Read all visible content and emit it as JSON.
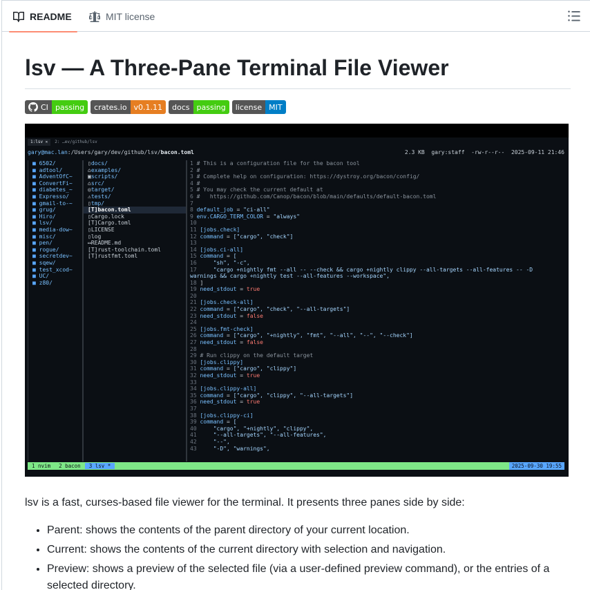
{
  "tabs": {
    "readme": "README",
    "license": "MIT license"
  },
  "title": "lsv — A Three-Pane Terminal File Viewer",
  "badges": [
    {
      "left": "CI",
      "right": "passing",
      "color": "#44cc11"
    },
    {
      "left": "crates.io",
      "right": "v0.1.11",
      "color": "#e67e22"
    },
    {
      "left": "docs",
      "right": "passing",
      "color": "#44cc11"
    },
    {
      "left": "license",
      "right": "MIT",
      "color": "#007ec6"
    }
  ],
  "terminal": {
    "tabs": [
      "1:lsv ✕",
      "2: …ev/github/lsv"
    ],
    "path_user": "gary@mac.lan",
    "path_dir": ":/Users/gary/dev/github/lsv/",
    "path_file": "bacon.toml",
    "meta": "2.3 KB  gary:staff  -rw-r--r--  2025-09-11 21:46",
    "parent_entries": [
      "6502/",
      "adtool/",
      "AdventOfC~",
      "ConvertFi~",
      "diabetes_~",
      "Expresso/",
      "gmail-to-~",
      "grug/",
      "Hiro/",
      "lsv/",
      "media-dow~",
      "misc/",
      "pen/",
      "rogue/",
      "secretdev~",
      "sqew/",
      "test_xcod~",
      "UC/",
      "z80/"
    ],
    "current_entries": [
      {
        "icon": "▯",
        "name": "docs/"
      },
      {
        "icon": "⌂",
        "name": "examples/"
      },
      {
        "icon": "▣",
        "name": "scripts/"
      },
      {
        "icon": "⌂",
        "name": "src/"
      },
      {
        "icon": "◎",
        "name": "target/"
      },
      {
        "icon": "⚠",
        "name": "tests/"
      },
      {
        "icon": "▯",
        "name": "tmp/"
      },
      {
        "icon": "[T]",
        "name": "bacon.toml"
      },
      {
        "icon": "▯",
        "name": "Cargo.lock"
      },
      {
        "icon": "[T]",
        "name": "Cargo.toml"
      },
      {
        "icon": "▯",
        "name": "LICENSE"
      },
      {
        "icon": "▯",
        "name": "log"
      },
      {
        "icon": "▭",
        "name": "README.md"
      },
      {
        "icon": "[T]",
        "name": "rust-toolchain.toml"
      },
      {
        "icon": "[T]",
        "name": "rustfmt.toml"
      }
    ],
    "preview_lines": [
      [
        "1",
        "cm",
        "# This is a configuration file for the bacon tool"
      ],
      [
        "2",
        "cm",
        "#"
      ],
      [
        "3",
        "cm",
        "# Complete help on configuration: https://dystroy.org/bacon/config/"
      ],
      [
        "4",
        "cm",
        "#"
      ],
      [
        "5",
        "cm",
        "# You may check the current default at"
      ],
      [
        "6",
        "cm",
        "#   https://github.com/Canop/bacon/blob/main/defaults/default-bacon.toml"
      ],
      [
        "7",
        "tx",
        ""
      ],
      [
        "8",
        "kv",
        "default_job = \"ci-all\""
      ],
      [
        "9",
        "kv",
        "env.CARGO_TERM_COLOR = \"always\""
      ],
      [
        "10",
        "tx",
        ""
      ],
      [
        "11",
        "hd",
        "[jobs.check]"
      ],
      [
        "12",
        "kv",
        "command = [\"cargo\", \"check\"]"
      ],
      [
        "13",
        "tx",
        ""
      ],
      [
        "14",
        "hd",
        "[jobs.ci-all]"
      ],
      [
        "15",
        "kv",
        "command = ["
      ],
      [
        "16",
        "st",
        "    \"sh\", \"-c\","
      ],
      [
        "17",
        "st",
        "    \"cargo +nightly fmt --all -- --check && cargo +nightly clippy --all-targets --all-features -- -D"
      ],
      [
        "",
        "st",
        "warnings && cargo +nightly test --all-features --workspace\","
      ],
      [
        "18",
        "tx",
        "]"
      ],
      [
        "19",
        "kb",
        "need_stdout = true"
      ],
      [
        "20",
        "tx",
        ""
      ],
      [
        "21",
        "hd",
        "[jobs.check-all]"
      ],
      [
        "22",
        "kv",
        "command = [\"cargo\", \"check\", \"--all-targets\"]"
      ],
      [
        "23",
        "kb",
        "need_stdout = false"
      ],
      [
        "24",
        "tx",
        ""
      ],
      [
        "25",
        "hd",
        "[jobs.fmt-check]"
      ],
      [
        "26",
        "kv",
        "command = [\"cargo\", \"+nightly\", \"fmt\", \"--all\", \"--\", \"--check\"]"
      ],
      [
        "27",
        "kb",
        "need_stdout = false"
      ],
      [
        "28",
        "tx",
        ""
      ],
      [
        "29",
        "cm",
        "# Run clippy on the default target"
      ],
      [
        "30",
        "hd",
        "[jobs.clippy]"
      ],
      [
        "31",
        "kv",
        "command = [\"cargo\", \"clippy\"]"
      ],
      [
        "32",
        "kb",
        "need_stdout = true"
      ],
      [
        "33",
        "tx",
        ""
      ],
      [
        "34",
        "hd",
        "[jobs.clippy-all]"
      ],
      [
        "35",
        "kv",
        "command = [\"cargo\", \"clippy\", \"--all-targets\"]"
      ],
      [
        "36",
        "kb",
        "need_stdout = true"
      ],
      [
        "37",
        "tx",
        ""
      ],
      [
        "38",
        "hd",
        "[jobs.clippy-ci]"
      ],
      [
        "39",
        "kv",
        "command = ["
      ],
      [
        "40",
        "st",
        "    \"cargo\", \"+nightly\", \"clippy\","
      ],
      [
        "41",
        "st",
        "    \"--all-targets\", \"--all-features\","
      ],
      [
        "42",
        "st",
        "    \"--\","
      ],
      [
        "43",
        "st",
        "    \"-D\", \"warnings\","
      ]
    ],
    "status_windows": [
      "1 nvim",
      "2 bacon",
      "3 lsv *"
    ],
    "status_datetime": "2025-09-30 19:55"
  },
  "description": "lsv is a fast, curses-based file viewer for the terminal. It presents three panes side by side:",
  "features": [
    "Parent: shows the contents of the parent directory of your current location.",
    "Current: shows the contents of the current directory with selection and navigation.",
    "Preview: shows a preview of the selected file (via a user-defined preview command), or the entries of a selected directory."
  ]
}
